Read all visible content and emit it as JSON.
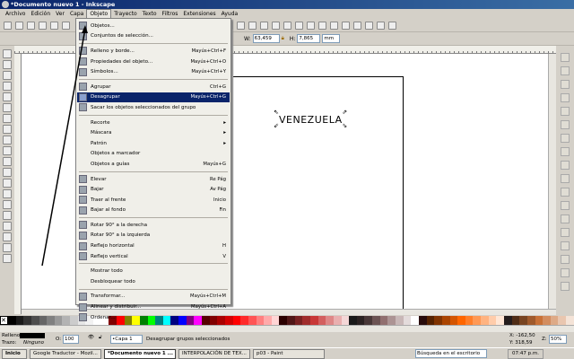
{
  "window": {
    "title": "*Documento nuevo 1 - Inkscape"
  },
  "menubar": [
    "Archivo",
    "Edición",
    "Ver",
    "Capa",
    "Objeto",
    "Trayecto",
    "Texto",
    "Filtros",
    "Extensiones",
    "Ayuda"
  ],
  "toolbar2": {
    "w_label": "W:",
    "w_value": "63,459",
    "h_label": "H:",
    "h_value": "7,865",
    "unit": "mm"
  },
  "menu": {
    "open": "Objeto",
    "items": [
      {
        "label": "Objetos...",
        "icon": "objects-icon"
      },
      {
        "label": "Conjuntos de selección...",
        "icon": "selection-sets-icon"
      },
      {
        "sep": true
      },
      {
        "label": "Relleno y borde...",
        "shortcut": "Mayús+Ctrl+F",
        "icon": "fill-stroke-icon"
      },
      {
        "label": "Propiedades del objeto...",
        "shortcut": "Mayús+Ctrl+O",
        "icon": "object-properties-icon"
      },
      {
        "label": "Símbolos...",
        "shortcut": "Mayús+Ctrl+Y",
        "icon": "symbols-icon"
      },
      {
        "sep": true
      },
      {
        "label": "Agrupar",
        "shortcut": "Ctrl+G",
        "icon": "group-icon"
      },
      {
        "label": "Desagrupar",
        "shortcut": "Mayús+Ctrl+G",
        "icon": "ungroup-icon",
        "highlighted": true
      },
      {
        "label": "Sacar los objetos seleccionados del grupo",
        "icon": "pop-group-icon"
      },
      {
        "sep": true
      },
      {
        "label": "Recorte",
        "submenu": true
      },
      {
        "label": "Máscara",
        "submenu": true
      },
      {
        "label": "Patrón",
        "submenu": true
      },
      {
        "label": "Objetos a marcador"
      },
      {
        "label": "Objetos a guías",
        "shortcut": "Mayús+G"
      },
      {
        "sep": true
      },
      {
        "label": "Elevar",
        "shortcut": "Re Pág",
        "icon": "raise-icon"
      },
      {
        "label": "Bajar",
        "shortcut": "Av Pág",
        "icon": "lower-icon"
      },
      {
        "label": "Traer al frente",
        "shortcut": "Inicio",
        "icon": "raise-top-icon"
      },
      {
        "label": "Bajar al fondo",
        "shortcut": "Fin",
        "icon": "lower-bottom-icon"
      },
      {
        "sep": true
      },
      {
        "label": "Rotar 90° a la derecha",
        "icon": "rotate-cw-icon"
      },
      {
        "label": "Rotar 90° a la izquierda",
        "icon": "rotate-ccw-icon"
      },
      {
        "label": "Reflejo horizontal",
        "shortcut": "H",
        "icon": "flip-horizontal-icon"
      },
      {
        "label": "Reflejo vertical",
        "shortcut": "V",
        "icon": "flip-vertical-icon"
      },
      {
        "sep": true
      },
      {
        "label": "Mostrar todo"
      },
      {
        "label": "Desbloquear todo"
      },
      {
        "sep": true
      },
      {
        "label": "Transformar...",
        "shortcut": "Mayús+Ctrl+M",
        "icon": "transform-icon"
      },
      {
        "label": "Alinear y distribuir...",
        "shortcut": "Mayús+Ctrl+A",
        "icon": "align-icon"
      },
      {
        "label": "Ordenar...",
        "icon": "arrange-icon"
      }
    ]
  },
  "canvas": {
    "text": "VENEZUELA"
  },
  "palette": [
    "#000000",
    "#1a1a1a",
    "#333333",
    "#4d4d4d",
    "#666666",
    "#808080",
    "#999999",
    "#b3b3b3",
    "#cccccc",
    "#e6e6e6",
    "#f2f2f2",
    "#ffffff",
    "#ffffff",
    "#800000",
    "#ff0000",
    "#808000",
    "#ffff00",
    "#008000",
    "#00ff00",
    "#008080",
    "#00ffff",
    "#000080",
    "#0000ff",
    "#800080",
    "#ff00ff",
    "#550000",
    "#800000",
    "#aa0000",
    "#d40000",
    "#ff0000",
    "#ff2a2a",
    "#ff5555",
    "#ff8080",
    "#ffaaaa",
    "#ffd5d5",
    "#2b0000",
    "#501616",
    "#782121",
    "#a02c2c",
    "#c83737",
    "#d35f5f",
    "#de8787",
    "#e9afaf",
    "#f4d7d7",
    "#1a1a1a",
    "#2b2222",
    "#483737",
    "#6c5353",
    "#916f6f",
    "#ac9393",
    "#c8b7b7",
    "#e3dbdb",
    "#ffffff",
    "#280b0b",
    "#552200",
    "#803300",
    "#aa4400",
    "#d45500",
    "#ff6600",
    "#ff7f2a",
    "#ff9955",
    "#ffb380",
    "#ffccaa",
    "#ffe6d5",
    "#241c1c",
    "#502d16",
    "#784421",
    "#a05a2c",
    "#c87137",
    "#d38d5f",
    "#deaa87",
    "#e9c6af",
    "#f4e3d7"
  ],
  "status": {
    "fill_label": "Relleno:",
    "fill_color": "#000000",
    "stroke_label": "Trazo:",
    "stroke_value": "Ninguno",
    "opacity_label": "O:",
    "opacity_value": "100",
    "layer": "•Capa 1",
    "message": "Desagrupar grupos seleccionados",
    "x_label": "X:",
    "x_value": "-162,50",
    "y_label": "Y:",
    "y_value": "318,59",
    "zoom_label": "Z:",
    "zoom_value": "50%"
  },
  "taskbar": {
    "start": "Inicio",
    "tasks": [
      "Google Traductor - Mozil...",
      "*Documento nuevo 1 ...",
      "INTERPOLACIÓN DE TEX...",
      "p03 - Paint"
    ],
    "active": 1,
    "search_placeholder": "Búsqueda en el escritorio",
    "clock": "07:47 p.m."
  }
}
